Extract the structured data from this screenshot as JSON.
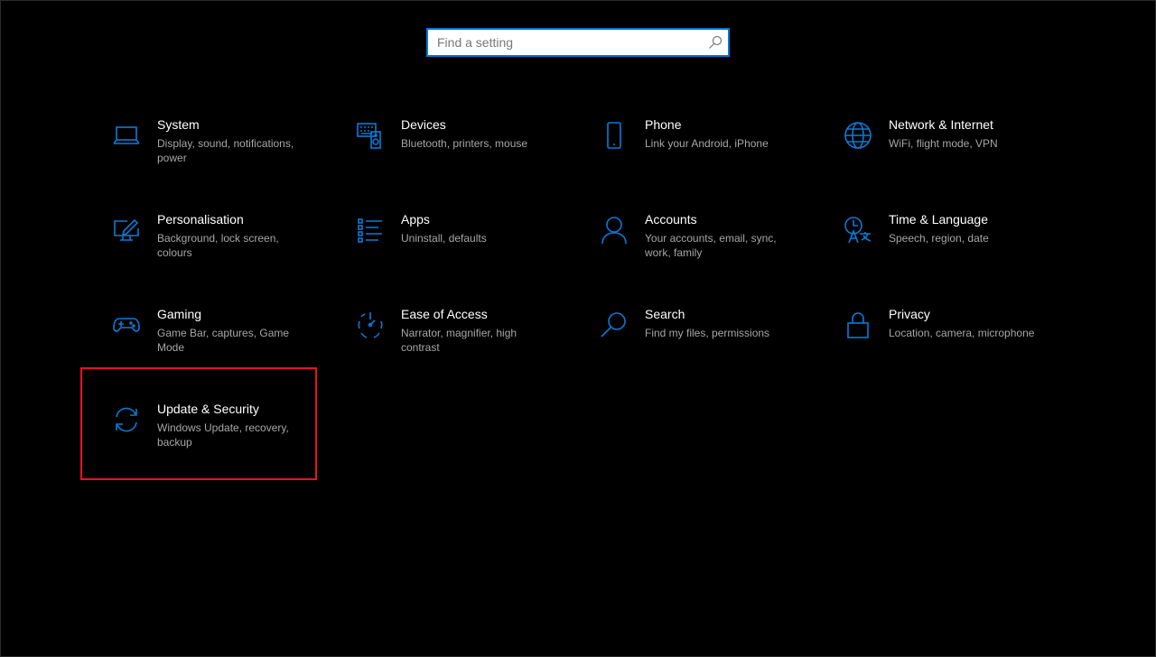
{
  "search": {
    "placeholder": "Find a setting",
    "icon": "search-icon"
  },
  "tiles": [
    {
      "title": "System",
      "desc": "Display, sound, notifications, power",
      "icon": "laptop-icon"
    },
    {
      "title": "Devices",
      "desc": "Bluetooth, printers, mouse",
      "icon": "keyboard-speaker-icon"
    },
    {
      "title": "Phone",
      "desc": "Link your Android, iPhone",
      "icon": "phone-icon"
    },
    {
      "title": "Network & Internet",
      "desc": "WiFi, flight mode, VPN",
      "icon": "globe-icon"
    },
    {
      "title": "Personalisation",
      "desc": "Background, lock screen, colours",
      "icon": "paint-monitor-icon"
    },
    {
      "title": "Apps",
      "desc": "Uninstall, defaults",
      "icon": "apps-list-icon"
    },
    {
      "title": "Accounts",
      "desc": "Your accounts, email, sync, work, family",
      "icon": "person-icon"
    },
    {
      "title": "Time & Language",
      "desc": "Speech, region, date",
      "icon": "time-language-icon"
    },
    {
      "title": "Gaming",
      "desc": "Game Bar, captures, Game Mode",
      "icon": "gamepad-icon"
    },
    {
      "title": "Ease of Access",
      "desc": "Narrator, magnifier, high contrast",
      "icon": "ease-of-access-icon"
    },
    {
      "title": "Search",
      "desc": "Find my files, permissions",
      "icon": "magnifier-icon"
    },
    {
      "title": "Privacy",
      "desc": "Location, camera, microphone",
      "icon": "lock-icon"
    },
    {
      "title": "Update & Security",
      "desc": "Windows Update, recovery, backup",
      "icon": "sync-icon"
    }
  ],
  "colors": {
    "accent": "#0078d7",
    "highlight": "#e81123"
  }
}
